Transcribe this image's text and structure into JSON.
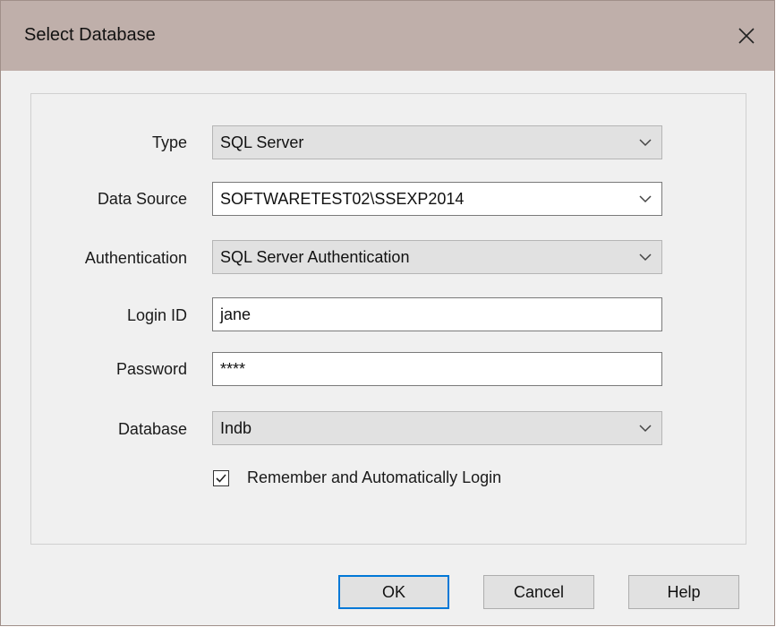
{
  "window": {
    "title": "Select Database",
    "close_icon": "close-icon"
  },
  "form": {
    "type": {
      "label": "Type",
      "value": "SQL Server"
    },
    "data_source": {
      "label": "Data Source",
      "value": "SOFTWARETEST02\\SSEXP2014"
    },
    "authentication": {
      "label": "Authentication",
      "value": "SQL Server Authentication"
    },
    "login_id": {
      "label": "Login ID",
      "value": "jane"
    },
    "password": {
      "label": "Password",
      "value": "****"
    },
    "database": {
      "label": "Database",
      "value": "Indb"
    },
    "remember": {
      "label": "Remember and Automatically Login",
      "checked": true
    }
  },
  "buttons": {
    "ok": "OK",
    "cancel": "Cancel",
    "help": "Help"
  },
  "colors": {
    "titlebar": "#bfafaa",
    "dialog_bg": "#f0f0f0",
    "focus_border": "#0078d7"
  }
}
